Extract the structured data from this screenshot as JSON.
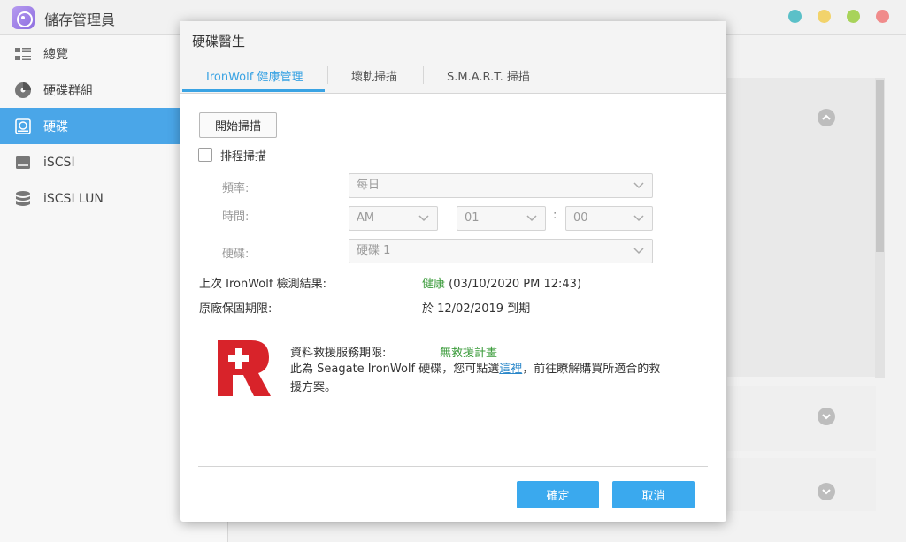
{
  "window": {
    "title": "儲存管理員",
    "controls": [
      {
        "name": "help",
        "color": "#5bc0c8"
      },
      {
        "name": "minimize",
        "color": "#f2d36b"
      },
      {
        "name": "maximize",
        "color": "#a8d35a"
      },
      {
        "name": "close",
        "color": "#f08b8b"
      }
    ]
  },
  "sidebar": {
    "items": [
      {
        "label": "總覽",
        "icon": "list-icon",
        "active": false
      },
      {
        "label": "硬碟群組",
        "icon": "disk-group-icon",
        "active": false
      },
      {
        "label": "硬碟",
        "icon": "hdd-icon",
        "active": true
      },
      {
        "label": "iSCSI",
        "icon": "iscsi-icon",
        "active": false
      },
      {
        "label": "iSCSI LUN",
        "icon": "database-icon",
        "active": false
      }
    ]
  },
  "dialog": {
    "title": "硬碟醫生",
    "tabs": [
      {
        "label": "IronWolf 健康管理",
        "active": true
      },
      {
        "label": "壞軌掃描",
        "active": false
      },
      {
        "label": "S.M.A.R.T. 掃描",
        "active": false
      }
    ],
    "start_scan_label": "開始掃描",
    "schedule": {
      "label": "排程掃描",
      "checked": false
    },
    "frequency": {
      "label": "頻率:",
      "value": "每日"
    },
    "time": {
      "label": "時間:",
      "ampm": "AM",
      "hour": "01",
      "separator": ":",
      "minute": "00"
    },
    "disk": {
      "label": "硬碟:",
      "value": "硬碟 1"
    },
    "last_result": {
      "label": "上次 IronWolf 檢測結果:",
      "status": "健康",
      "timestamp": "(03/10/2020 PM 12:43)"
    },
    "warranty": {
      "label": "原廠保固期限:",
      "value": "於 12/02/2019 到期"
    },
    "rescue": {
      "label": "資料救援服務期限:",
      "value": "無救援計畫",
      "desc_before": "此為 Seagate IronWolf 硬碟，您可點選",
      "link": "這裡",
      "desc_after": "，前往瞭解購買所適合的救援方案。"
    },
    "ok_label": "確定",
    "cancel_label": "取消"
  },
  "colors": {
    "accent": "#3aa9ee",
    "sidebar_active": "#4aa6e8",
    "healthy": "#3a9b3a",
    "rescue_logo": "#d8232a"
  }
}
